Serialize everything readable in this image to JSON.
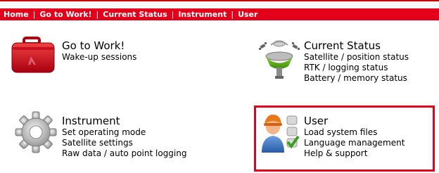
{
  "nav": {
    "items": [
      "Home",
      "Go to Work!",
      "Current Status",
      "Instrument",
      "User"
    ],
    "separator": "|"
  },
  "tiles": {
    "work": {
      "title": "Go to Work!",
      "lines": [
        "Wake-up sessions"
      ],
      "icon": "red-case-icon"
    },
    "status": {
      "title": "Current Status",
      "lines": [
        "Satellite / position status",
        "RTK / logging status",
        "Battery / memory status"
      ],
      "icon": "antenna-satellite-icon"
    },
    "instrument": {
      "title": "Instrument",
      "lines": [
        "Set operating mode",
        "Satellite settings",
        "Raw data / auto point logging"
      ],
      "icon": "gear-icon"
    },
    "user": {
      "title": "User",
      "lines": [
        "Load system files",
        "Language management",
        "Help & support"
      ],
      "icon": "user-checklist-icon"
    }
  },
  "colors": {
    "nav_bar": "#e3001b",
    "highlight_border": "#e3001b"
  }
}
